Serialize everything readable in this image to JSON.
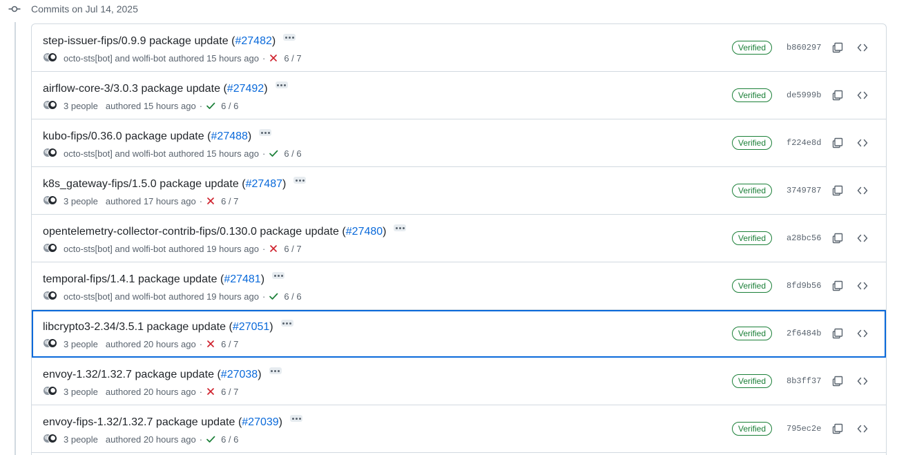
{
  "group": {
    "title": "Commits on Jul 14, 2025"
  },
  "colors": {
    "link": "#0969da",
    "verified": "#1a7f37",
    "failure": "#cf222e",
    "success": "#1a7f37",
    "muted": "#59636e",
    "selected_outline": "#0969da"
  },
  "commits": [
    {
      "title": "step-issuer-fips/0.9.9 package update",
      "pr": "#27482",
      "authors": "octo-sts[bot] and wolfi-bot",
      "authored": "authored 15 hours ago",
      "status": "failure",
      "checks": "6 / 7",
      "verified": "Verified",
      "sha": "b860297",
      "selected": false
    },
    {
      "title": "airflow-core-3/3.0.3 package update",
      "pr": "#27492",
      "authors": "3 people",
      "authored": "authored 15 hours ago",
      "status": "success",
      "checks": "6 / 6",
      "verified": "Verified",
      "sha": "de5999b",
      "selected": false
    },
    {
      "title": "kubo-fips/0.36.0 package update",
      "pr": "#27488",
      "authors": "octo-sts[bot] and wolfi-bot",
      "authored": "authored 15 hours ago",
      "status": "success",
      "checks": "6 / 6",
      "verified": "Verified",
      "sha": "f224e8d",
      "selected": false
    },
    {
      "title": "k8s_gateway-fips/1.5.0 package update",
      "pr": "#27487",
      "authors": "3 people",
      "authored": "authored 17 hours ago",
      "status": "failure",
      "checks": "6 / 7",
      "verified": "Verified",
      "sha": "3749787",
      "selected": false
    },
    {
      "title": "opentelemetry-collector-contrib-fips/0.130.0 package update",
      "pr": "#27480",
      "authors": "octo-sts[bot] and wolfi-bot",
      "authored": "authored 19 hours ago",
      "status": "failure",
      "checks": "6 / 7",
      "verified": "Verified",
      "sha": "a28bc56",
      "selected": false
    },
    {
      "title": "temporal-fips/1.4.1 package update",
      "pr": "#27481",
      "authors": "octo-sts[bot] and wolfi-bot",
      "authored": "authored 19 hours ago",
      "status": "success",
      "checks": "6 / 6",
      "verified": "Verified",
      "sha": "8fd9b56",
      "selected": false
    },
    {
      "title": "libcrypto3-2.34/3.5.1 package update",
      "pr": "#27051",
      "authors": "3 people",
      "authored": "authored 20 hours ago",
      "status": "failure",
      "checks": "6 / 7",
      "verified": "Verified",
      "sha": "2f6484b",
      "selected": true
    },
    {
      "title": "envoy-1.32/1.32.7 package update",
      "pr": "#27038",
      "authors": "3 people",
      "authored": "authored 20 hours ago",
      "status": "failure",
      "checks": "6 / 7",
      "verified": "Verified",
      "sha": "8b3ff37",
      "selected": false
    },
    {
      "title": "envoy-fips-1.32/1.32.7 package update",
      "pr": "#27039",
      "authors": "3 people",
      "authored": "authored 20 hours ago",
      "status": "success",
      "checks": "6 / 6",
      "verified": "Verified",
      "sha": "795ec2e",
      "selected": false
    }
  ]
}
